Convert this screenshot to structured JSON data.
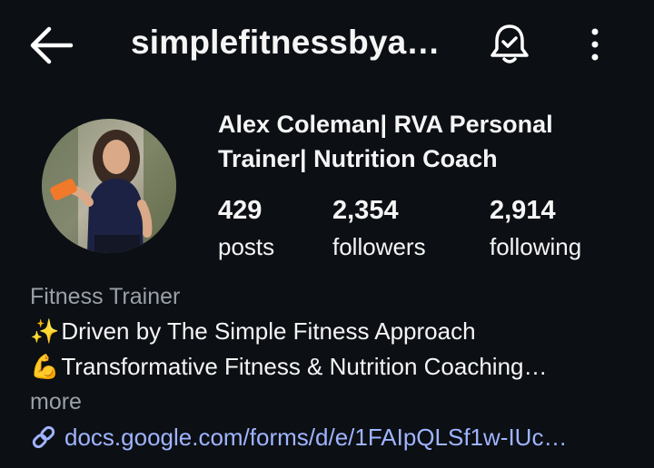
{
  "header": {
    "username": "simplefitnessbya…",
    "back_icon": "arrow-left-icon",
    "notification_icon": "bell-check-icon",
    "menu_icon": "more-vertical-icon"
  },
  "profile": {
    "display_name": "Alex Coleman| RVA Personal Trainer| Nutrition Coach",
    "stats": [
      {
        "value": "429",
        "label": "posts"
      },
      {
        "value": "2,354",
        "label": "followers"
      },
      {
        "value": "2,914",
        "label": "following"
      }
    ]
  },
  "bio": {
    "category": "Fitness Trainer",
    "lines": [
      {
        "emoji": "✨",
        "text": "Driven by The Simple Fitness Approach"
      },
      {
        "emoji": "💪",
        "text": "Transformative Fitness & Nutrition Coaching…"
      }
    ],
    "more_label": "more",
    "link_text": "docs.google.com/forms/d/e/1FAIpQLSf1w-IUc…",
    "link_icon": "link-icon"
  },
  "colors": {
    "background": "#0c0f14",
    "text": "#f5f5f5",
    "muted": "#9aa0a8",
    "link": "#9fb4ff"
  }
}
